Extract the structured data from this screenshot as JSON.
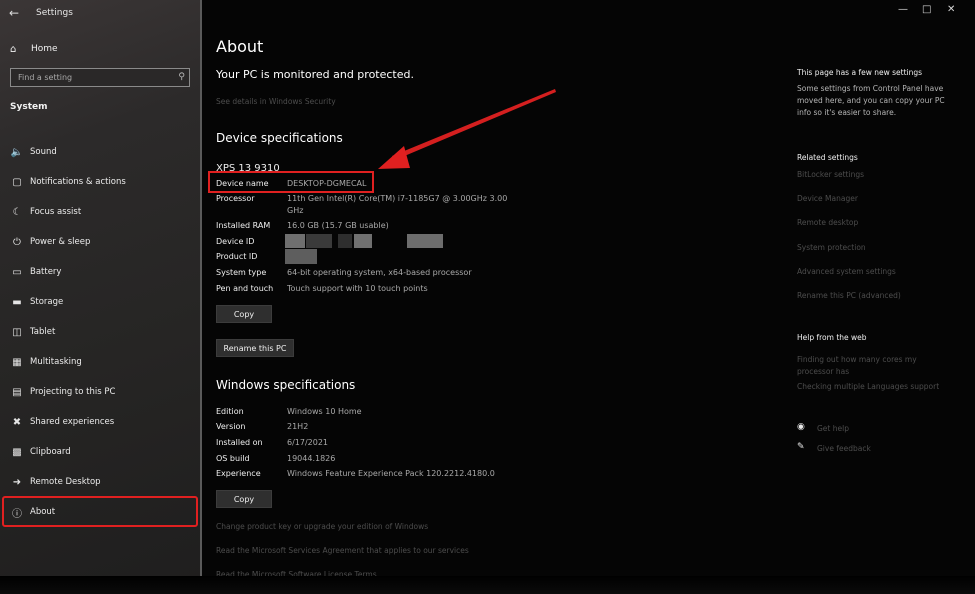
{
  "app": {
    "title": "Settings",
    "back_icon": "arrow-left-icon"
  },
  "sidebar": {
    "home_label": "Home",
    "search_placeholder": "Find a setting",
    "section": "System",
    "items": [
      {
        "label": "Sound",
        "icon": "speaker-icon"
      },
      {
        "label": "Notifications & actions",
        "icon": "notification-icon"
      },
      {
        "label": "Focus assist",
        "icon": "moon-icon"
      },
      {
        "label": "Power & sleep",
        "icon": "power-icon"
      },
      {
        "label": "Battery",
        "icon": "battery-icon"
      },
      {
        "label": "Storage",
        "icon": "storage-icon"
      },
      {
        "label": "Tablet",
        "icon": "tablet-icon"
      },
      {
        "label": "Multitasking",
        "icon": "multitasking-icon"
      },
      {
        "label": "Projecting to this PC",
        "icon": "projector-icon"
      },
      {
        "label": "Shared experiences",
        "icon": "share-icon"
      },
      {
        "label": "Clipboard",
        "icon": "clipboard-icon"
      },
      {
        "label": "Remote Desktop",
        "icon": "remote-desktop-icon"
      },
      {
        "label": "About",
        "icon": "info-icon",
        "selected": true
      }
    ]
  },
  "main": {
    "title": "About",
    "protection_status": "Your PC is monitored and protected.",
    "security_link": "See details in Windows Security",
    "device_specs": {
      "heading": "Device specifications",
      "model": "XPS 13 9310",
      "rows": [
        {
          "label": "Device name",
          "value": "DESKTOP-DGMECAL"
        },
        {
          "label": "Processor",
          "value": "11th Gen Intel(R) Core(TM) i7-1185G7 @ 3.00GHz   3.00",
          "value2": "GHz"
        },
        {
          "label": "Installed RAM",
          "value": "16.0 GB (15.7 GB usable)"
        },
        {
          "label": "Device ID",
          "value": ""
        },
        {
          "label": "Product ID",
          "value": ""
        },
        {
          "label": "System type",
          "value": "64-bit operating system, x64-based processor"
        },
        {
          "label": "Pen and touch",
          "value": "Touch support with 10 touch points"
        }
      ],
      "copy_button": "Copy",
      "rename_button": "Rename this PC"
    },
    "windows_specs": {
      "heading": "Windows specifications",
      "rows": [
        {
          "label": "Edition",
          "value": "Windows 10 Home"
        },
        {
          "label": "Version",
          "value": "21H2"
        },
        {
          "label": "Installed on",
          "value": "6/17/2021"
        },
        {
          "label": "OS build",
          "value": "19044.1826"
        },
        {
          "label": "Experience",
          "value": "Windows Feature Experience Pack 120.2212.4180.0"
        }
      ],
      "copy_button": "Copy"
    },
    "links": [
      "Change product key or upgrade your edition of Windows",
      "Read the Microsoft Services Agreement that applies to our services",
      "Read the Microsoft Software License Terms"
    ]
  },
  "right_panel": {
    "new_settings_title": "This page has a few new settings",
    "new_settings_text": "Some settings from Control Panel have moved here, and you can copy your PC info so it's easier to share.",
    "related_title": "Related settings",
    "related_links": [
      "BitLocker settings",
      "Device Manager",
      "Remote desktop",
      "System protection",
      "Advanced system settings",
      "Rename this PC (advanced)"
    ],
    "help_title": "Help from the web",
    "help_links": [
      "Finding out how many cores my processor has",
      "Checking multiple Languages support"
    ],
    "get_help": "Get help",
    "give_feedback": "Give feedback"
  },
  "colors": {
    "highlight": "#e02020",
    "sidebar_bg": "#2a2828",
    "main_bg": "#050505"
  }
}
